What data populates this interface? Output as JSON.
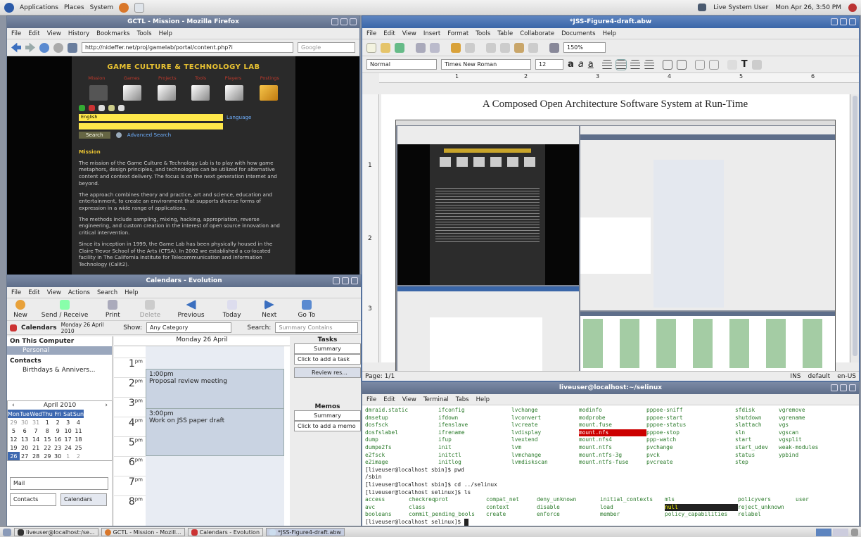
{
  "topbar": {
    "applications": "Applications",
    "places": "Places",
    "system": "System",
    "user": "Live System User",
    "clock": "Mon Apr 26,  3:50 PM"
  },
  "firefox": {
    "title": "GCTL - Mission - Mozilla Firefox",
    "menu": [
      "File",
      "Edit",
      "View",
      "History",
      "Bookmarks",
      "Tools",
      "Help"
    ],
    "url": "http://nideffer.net/proj/gamelab/portal/content.php?i",
    "search_placeholder": "Google",
    "site": {
      "heading": "GAME CULTURE & TECHNOLOGY LAB",
      "nav": [
        "Mission",
        "Games",
        "Projects",
        "Tools",
        "Players",
        "Postings"
      ],
      "lang_value": "English",
      "lang_link": "Language",
      "search_btn": "Search",
      "adv_search": "Advanced Search",
      "section": "Mission",
      "p1": "The mission of the Game Culture & Technology Lab is to play with how game metaphors, design principles, and technologies can be utilized for alternative content and context delivery. The focus is on the next generation Internet and beyond.",
      "p2": "The approach combines theory and practice, art and science, education and entertainment, to create an environment that supports diverse forms of expression in a wide range of applications.",
      "p3": "The methods include sampling, mixing, hacking, appropriation, reverse engineering, and custom creation in the interest of open source innovation and critical intervention.",
      "p4": "Since its inception in 1999, the Game Lab has been physically housed in the Claire Trevor School of the Arts (CTSA). In 2002 we established a co-located facility in The California Institute for Telecommunication and Information Technology (Calit2)."
    }
  },
  "evolution": {
    "title": "Calendars - Evolution",
    "menu": [
      "File",
      "Edit",
      "View",
      "Actions",
      "Search",
      "Help"
    ],
    "toolbar": [
      "New",
      "Send / Receive",
      "Print",
      "Delete",
      "Previous",
      "Today",
      "Next",
      "Go To"
    ],
    "calendars_label": "Calendars",
    "date_label": "Monday 26 April 2010",
    "show_label": "Show:",
    "category": "Any Category",
    "search_label": "Search:",
    "search_placeholder": "Summary Contains",
    "tree": {
      "group1": "On This Computer",
      "personal": "Personal",
      "group2": "Contacts",
      "birthdays": "Birthdays & Annivers..."
    },
    "day_header": "Monday 26 April",
    "hours": [
      "1",
      "2",
      "3",
      "4",
      "5",
      "6",
      "7",
      "8"
    ],
    "pm": "pm",
    "event1_time": "1:00pm",
    "event1_title": "Proposal review meeting",
    "event2_time": "3:00pm",
    "event2_title": "Work on JSS paper draft",
    "tasks_header": "Tasks",
    "tasks_col": "Summary",
    "tasks_add": "Click to add a task",
    "task1": "Review res...",
    "memos_header": "Memos",
    "memos_col": "Summary",
    "memos_add": "Click to add a memo",
    "month": "April 2010",
    "weekdays": [
      "Mon",
      "Tue",
      "Wed",
      "Thu",
      "Fri",
      "Sat",
      "Sun"
    ],
    "weeks": [
      [
        "29",
        "30",
        "31",
        "1",
        "2",
        "3",
        "4"
      ],
      [
        "5",
        "6",
        "7",
        "8",
        "9",
        "10",
        "11"
      ],
      [
        "12",
        "13",
        "14",
        "15",
        "16",
        "17",
        "18"
      ],
      [
        "19",
        "20",
        "21",
        "22",
        "23",
        "24",
        "25"
      ],
      [
        "26",
        "27",
        "28",
        "29",
        "30",
        "1",
        "2"
      ]
    ],
    "switcher": [
      "Mail",
      "Contacts",
      "Calendars"
    ]
  },
  "abiword": {
    "title": "*JSS-Figure4-draft.abw",
    "menu": [
      "File",
      "Edit",
      "View",
      "Insert",
      "Format",
      "Tools",
      "Table",
      "Collaborate",
      "Documents",
      "Help"
    ],
    "zoom": "150%",
    "style": "Normal",
    "font": "Times New Roman",
    "size": "12",
    "ruler_marks": [
      "1",
      "2",
      "3",
      "4",
      "5",
      "6"
    ],
    "vruler_marks": [
      "1",
      "2",
      "3"
    ],
    "doc_title": "A Composed Open Architecture Software System at Run-Time",
    "status_page": "Page: 1/1",
    "status_ins": "INS",
    "status_default": "default",
    "status_lang": "en-US"
  },
  "terminal": {
    "title": "liveuser@localhost:~/selinux",
    "menu": [
      "File",
      "Edit",
      "View",
      "Terminal",
      "Tabs",
      "Help"
    ],
    "grid": [
      [
        "dmraid.static",
        "ifconfig",
        "lvchange",
        "modinfo",
        "pppoe-sniff",
        "sfdisk",
        "vgremove"
      ],
      [
        "dmsetup",
        "ifdown",
        "lvconvert",
        "modprobe",
        "pppoe-start",
        "shutdown",
        "vgrename"
      ],
      [
        "dosfsck",
        "ifenslave",
        "lvcreate",
        "mount.fuse",
        "pppoe-status",
        "slattach",
        "vgs"
      ],
      [
        "dosfslabel",
        "ifrename",
        "lvdisplay",
        "mount.nfs",
        "pppoe-stop",
        "sln",
        "vgscan"
      ],
      [
        "dump",
        "ifup",
        "lvextend",
        "mount.nfs4",
        "ppp-watch",
        "start",
        "vgsplit"
      ],
      [
        "dumpe2fs",
        "init",
        "lvm",
        "mount.ntfs",
        "pvchange",
        "start_udev",
        "weak-modules"
      ],
      [
        "e2fsck",
        "initctl",
        "lvmchange",
        "mount.ntfs-3g",
        "pvck",
        "status",
        "ypbind"
      ],
      [
        "e2image",
        "initlog",
        "lvmdiskscan",
        "mount.ntfs-fuse",
        "pvcreate",
        "step",
        ""
      ]
    ],
    "line_pwd": "[liveuser@localhost sbin]$ pwd",
    "line_sbin": "/sbin",
    "line_cd": "[liveuser@localhost sbin]$ cd ../selinux",
    "line_ls": "[liveuser@localhost selinux]$ ls",
    "ls_grid": [
      [
        "access",
        "checkreqprot",
        "compat_net",
        "deny_unknown",
        "initial_contexts",
        "mls",
        "policyvers",
        "user"
      ],
      [
        "avc",
        "class",
        "context",
        "disable",
        "load",
        "null",
        "reject_unknown",
        ""
      ],
      [
        "booleans",
        "commit_pending_bools",
        "create",
        "enforce",
        "member",
        "policy_capabilities",
        "relabel",
        ""
      ]
    ],
    "prompt": "[liveuser@localhost selinux]$ "
  },
  "taskbar": [
    "liveuser@localhost:/se...",
    "GCTL - Mission - Mozill...",
    "Calendars - Evolution",
    "*JSS-Figure4-draft.abw"
  ]
}
